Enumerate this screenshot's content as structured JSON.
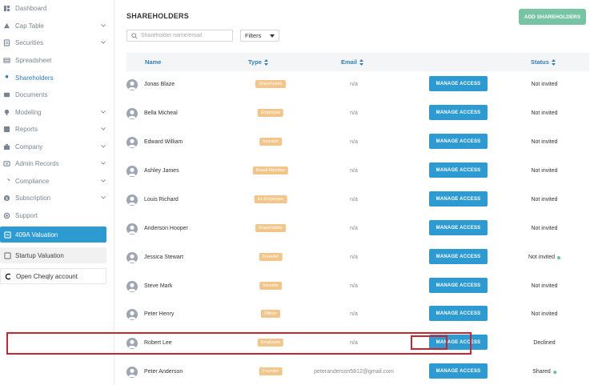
{
  "sidebar": {
    "items": [
      {
        "label": "Dashboard",
        "icon": "dashboard-icon",
        "has_chevron": false,
        "active": false
      },
      {
        "label": "Cap Table",
        "icon": "cap-table-icon",
        "has_chevron": true,
        "active": false
      },
      {
        "label": "Securities",
        "icon": "securities-icon",
        "has_chevron": true,
        "active": false
      },
      {
        "label": "Spreadsheet",
        "icon": "spreadsheet-icon",
        "has_chevron": false,
        "active": false
      },
      {
        "label": "Shareholders",
        "icon": "shareholders-icon",
        "has_chevron": false,
        "active": true
      },
      {
        "label": "Documents",
        "icon": "documents-icon",
        "has_chevron": false,
        "active": false
      },
      {
        "label": "Modeling",
        "icon": "modeling-icon",
        "has_chevron": true,
        "active": false
      },
      {
        "label": "Reports",
        "icon": "reports-icon",
        "has_chevron": true,
        "active": false
      },
      {
        "label": "Company",
        "icon": "company-icon",
        "has_chevron": true,
        "active": false
      },
      {
        "label": "Admin Records",
        "icon": "admin-records-icon",
        "has_chevron": true,
        "active": false
      },
      {
        "label": "Compliance",
        "icon": "compliance-icon",
        "has_chevron": true,
        "active": false
      },
      {
        "label": "Subscription",
        "icon": "subscription-icon",
        "has_chevron": true,
        "active": false
      },
      {
        "label": "Support",
        "icon": "support-icon",
        "has_chevron": false,
        "active": false
      }
    ],
    "valuation_409a": "409A Valuation",
    "startup_valuation": "Startup Valuation",
    "open_cheqly": "Open Cheqly account"
  },
  "main": {
    "title": "SHAREHOLDERS",
    "add_button": "ADD SHAREHOLDERS",
    "search_placeholder": "Shareholder name/email",
    "filters_label": "Filters",
    "columns": {
      "name": "Name",
      "type": "Type",
      "email": "Email",
      "status": "Status"
    },
    "manage_label": "MANAGE ACCESS",
    "rows": [
      {
        "name": "Jonas Blaze",
        "type": "Shareholder",
        "email": "n/a",
        "status": "Not invited",
        "status_dot": false
      },
      {
        "name": "Bella Micheal",
        "type": "Employee",
        "email": "n/a",
        "status": "Not invited",
        "status_dot": false
      },
      {
        "name": "Edward William",
        "type": "Investor",
        "email": "n/a",
        "status": "Not invited",
        "status_dot": false
      },
      {
        "name": "Ashley James",
        "type": "Board Member",
        "email": "n/a",
        "status": "Not invited",
        "status_dot": false
      },
      {
        "name": "Louis Richard",
        "type": "Ex-Employee",
        "email": "n/a",
        "status": "Not invited",
        "status_dot": false
      },
      {
        "name": "Anderson Hooper",
        "type": "Shareholder",
        "email": "n/a",
        "status": "Not invited",
        "status_dot": false
      },
      {
        "name": "Jessica Stewart",
        "type": "Founder",
        "email": "n/a",
        "status": "Not invited",
        "status_dot": true
      },
      {
        "name": "Steve Mark",
        "type": "Investor",
        "email": "n/a",
        "status": "Not invited",
        "status_dot": false
      },
      {
        "name": "Peter Henry",
        "type": "Officer",
        "email": "n/a",
        "status": "Not invited",
        "status_dot": false
      },
      {
        "name": "Robert Lee",
        "type": "Employee",
        "email": "n/a",
        "status": "Declined",
        "status_dot": false,
        "highlighted": true
      },
      {
        "name": "Peter Anderson",
        "type": "Founder",
        "email": "peteranderson5812@gmail.com",
        "status": "Shared",
        "status_dot": true
      }
    ]
  },
  "colors": {
    "accent": "#2d9ad2",
    "add_button": "#76c4a4",
    "badge": "#f2c58b",
    "highlight": "#c9242f",
    "status_dot": "#6cc3a0"
  }
}
